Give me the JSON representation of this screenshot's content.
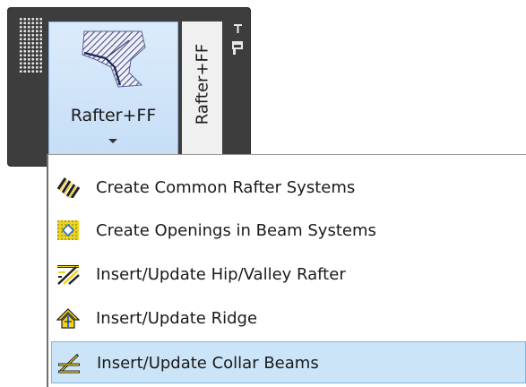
{
  "panel": {
    "big_button": {
      "label": "Rafter+FF",
      "icon": "rafter-framing-icon"
    },
    "side_tab": {
      "label": "Rafter+FF"
    },
    "icons": {
      "grip": "panel-grip-icon",
      "collapse": "return-to-ribbon-icon"
    }
  },
  "menu": {
    "items": [
      {
        "label": "Create Common Rafter Systems",
        "icon": "common-rafter-icon",
        "highlighted": false
      },
      {
        "label": "Create Openings in Beam Systems",
        "icon": "beam-opening-icon",
        "highlighted": false
      },
      {
        "label": "Insert/Update Hip/Valley Rafter",
        "icon": "hip-valley-rafter-icon",
        "highlighted": false
      },
      {
        "label": "Insert/Update Ridge",
        "icon": "ridge-icon",
        "highlighted": false
      },
      {
        "label": "Insert/Update Collar Beams",
        "icon": "collar-beam-icon",
        "highlighted": true
      }
    ]
  },
  "colors": {
    "panel_background": "#3d3d3d",
    "button_highlight": "#c4ddf6",
    "menu_highlight": "#cce4f7",
    "icon_yellow": "#f2d21b"
  }
}
